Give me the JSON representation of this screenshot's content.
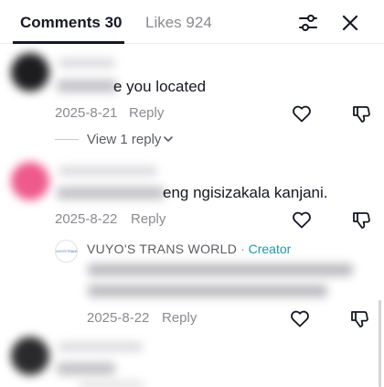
{
  "tabs": [
    {
      "label": "Comments 30",
      "active": true
    },
    {
      "label": "Likes 924",
      "active": false
    }
  ],
  "toolbar": {
    "filter_icon": "sliders-icon",
    "close_icon": "close-icon"
  },
  "comments": [
    {
      "text": "e you located",
      "date": "2025-8-21",
      "reply_label": "Reply",
      "view_replies": "View 1 reply"
    },
    {
      "text": "eng ngisizakala kanjani.",
      "date": "2025-8-22",
      "reply_label": "Reply",
      "reply": {
        "author": "VUYO'S TRANS WORLD",
        "separator": "·",
        "badge": "Creator",
        "date": "2025-8-22",
        "reply_label": "Reply"
      }
    }
  ],
  "colors": {
    "text": "#161823",
    "muted": "#8a8b91",
    "creator_badge": "#1b9aaa",
    "avatar_pink": "#ee5a8c",
    "avatar_dark": "#1d1d1f"
  }
}
